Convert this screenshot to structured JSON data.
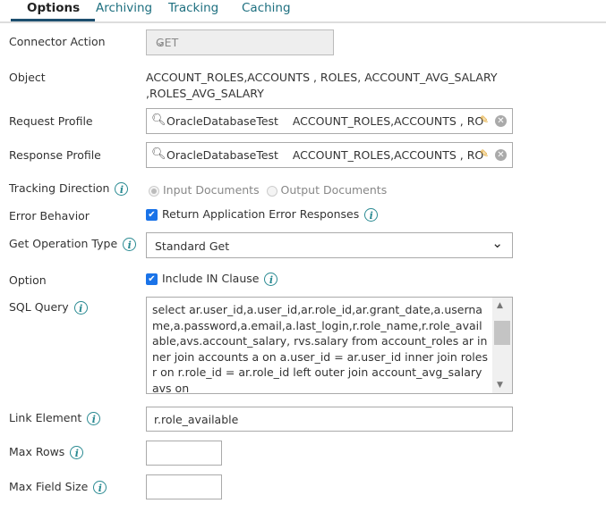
{
  "tabs": [
    "Options",
    "Archiving",
    "Tracking",
    "Caching"
  ],
  "labels": {
    "connector_action": "Connector Action",
    "object": "Object",
    "request_profile": "Request Profile",
    "response_profile": "Response Profile",
    "tracking_direction": "Tracking Direction",
    "error_behavior": "Error Behavior",
    "get_operation_type": "Get Operation Type",
    "option": "Option",
    "sql_query": "SQL Query",
    "link_element": "Link Element",
    "max_rows": "Max Rows",
    "max_field_size": "Max Field Size"
  },
  "connector_action": "GET",
  "object_line1": "ACCOUNT_ROLES,ACCOUNTS , ROLES, ACCOUNT_AVG_SALARY",
  "object_line2": ",ROLES_AVG_SALARY",
  "request_profile": "OracleDatabaseTest    ACCOUNT_ROLES,ACCOUNTS , RO",
  "response_profile": "OracleDatabaseTest    ACCOUNT_ROLES,ACCOUNTS , RO",
  "tracking": {
    "input": "Input Documents",
    "output": "Output Documents",
    "selected": "input"
  },
  "error_behavior": {
    "label": "Return Application Error Responses",
    "checked": true
  },
  "get_operation_type": "Standard Get",
  "option": {
    "label": "Include IN Clause",
    "checked": true
  },
  "sql_query": "select ar.user_id,a.user_id,ar.role_id,ar.grant_date,a.username,a.password,a.email,a.last_login,r.role_name,r.role_available,avs.account_salary, rvs.salary from account_roles ar  inner join accounts a on a.user_id = ar.user_id inner join roles r on r.role_id = ar.role_id  left outer join account_avg_salary avs on",
  "link_element": "r.role_available",
  "max_rows": "",
  "max_field_size": "",
  "colors": {
    "accent": "#1d6f7f",
    "info": "#2a8a92",
    "checkbox": "#1a73e8"
  }
}
